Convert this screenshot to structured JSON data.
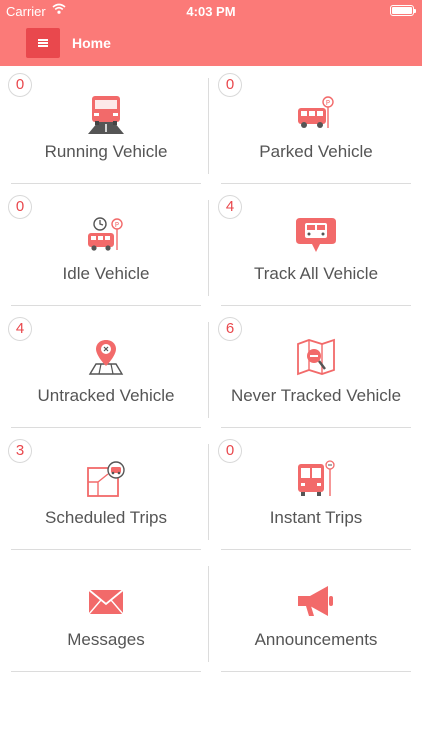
{
  "status_bar": {
    "carrier": "Carrier",
    "time": "4:03 PM"
  },
  "header": {
    "title": "Home",
    "menu_icon": "hamburger-menu-icon"
  },
  "colors": {
    "brand": "#fb7a78",
    "accent": "#e9484d",
    "divider": "#dcdcdc",
    "text": "#555555"
  },
  "tiles": [
    {
      "label": "Running Vehicle",
      "count": "0",
      "icon": "running-bus-icon"
    },
    {
      "label": "Parked Vehicle",
      "count": "0",
      "icon": "parked-bus-icon"
    },
    {
      "label": "Idle Vehicle",
      "count": "0",
      "icon": "idle-bus-icon"
    },
    {
      "label": "Track All Vehicle",
      "count": "4",
      "icon": "track-bus-icon"
    },
    {
      "label": "Untracked Vehicle",
      "count": "4",
      "icon": "map-pin-icon"
    },
    {
      "label": "Never Tracked Vehicle",
      "count": "6",
      "icon": "map-search-icon"
    },
    {
      "label": "Scheduled Trips",
      "count": "3",
      "icon": "schedule-map-icon"
    },
    {
      "label": "Instant Trips",
      "count": "0",
      "icon": "bus-stop-icon"
    },
    {
      "label": "Messages",
      "icon": "envelope-icon"
    },
    {
      "label": "Announcements",
      "icon": "megaphone-icon"
    }
  ]
}
